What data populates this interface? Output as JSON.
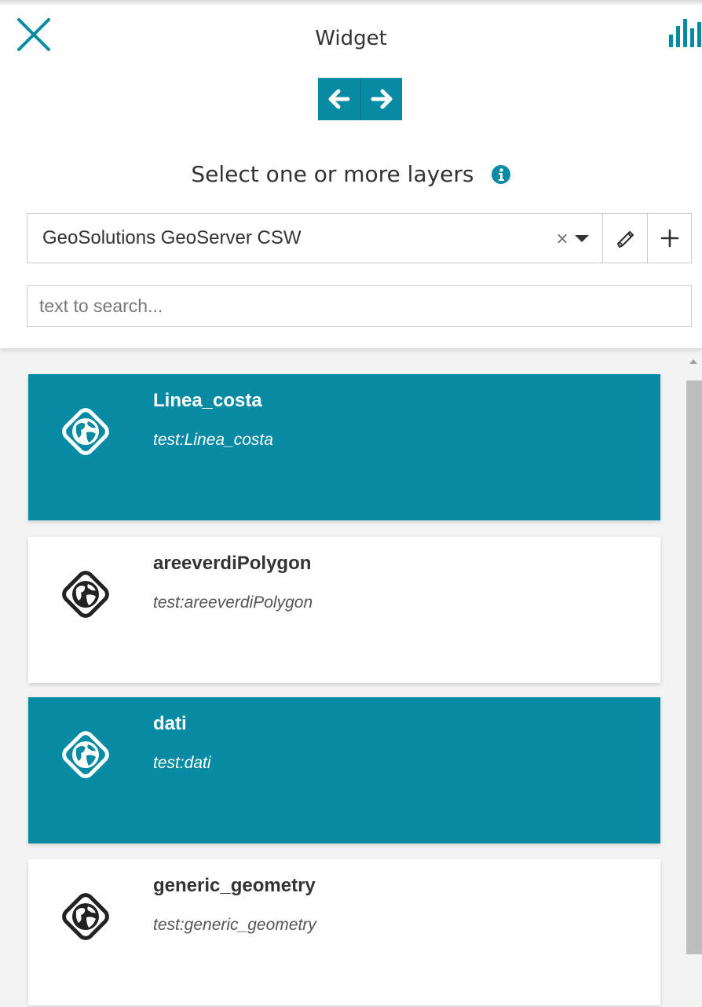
{
  "header": {
    "title": "Widget",
    "close_icon": "close-icon",
    "chart_icon": "bar-chart-icon"
  },
  "navigation": {
    "back_icon": "arrow-left-icon",
    "forward_icon": "arrow-right-icon"
  },
  "selection": {
    "label": "Select one or more layers",
    "info_icon": "info-circle-icon"
  },
  "catalog": {
    "selected_value": "GeoSolutions GeoServer CSW",
    "clear_symbol": "×",
    "edit_icon": "pencil-icon",
    "add_icon": "plus-icon"
  },
  "search": {
    "placeholder": "text to search..."
  },
  "layers": [
    {
      "title": "Linea_costa",
      "description": "test:Linea_costa",
      "selected": true,
      "icon": "globe-icon"
    },
    {
      "title": "areeverdiPolygon",
      "description": "test:areeverdiPolygon",
      "selected": false,
      "icon": "globe-icon"
    },
    {
      "title": "dati",
      "description": "test:dati",
      "selected": true,
      "icon": "globe-icon"
    },
    {
      "title": "generic_geometry",
      "description": "test:generic_geometry",
      "selected": false,
      "icon": "globe-icon"
    }
  ],
  "colors": {
    "accent": "#078aa3",
    "card_bg": "#ffffff",
    "list_bg": "#f3f3f3",
    "text": "#333333"
  }
}
